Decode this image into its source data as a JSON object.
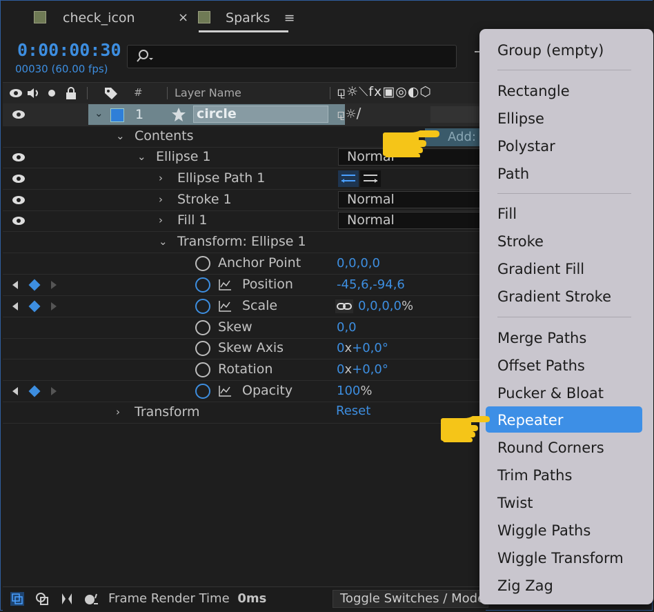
{
  "tabs": [
    {
      "label": "check_icon"
    },
    {
      "label": "Sparks"
    }
  ],
  "tab_close": "×",
  "tab_menu": "≡",
  "timecode": "0:00:00:30",
  "fps": "00030 (60.00 fps)",
  "search": {
    "placeholder": ""
  },
  "header": {
    "hash": "#",
    "layer_name": "Layer Name",
    "switches": "⚼☼⟍fx▣◎◐⬡"
  },
  "layer": {
    "number": "1",
    "name": "circle",
    "add_label": "Add:"
  },
  "rows": {
    "contents": "Contents",
    "ellipse1": "Ellipse 1",
    "ellipse1_mode": "Normal",
    "ellipse_path": "Ellipse Path 1",
    "stroke1": "Stroke 1",
    "stroke1_mode": "Normal",
    "fill1": "Fill 1",
    "fill1_mode": "Normal",
    "transform_ellipse": "Transform: Ellipse 1",
    "anchor": "Anchor Point",
    "anchor_val": "0,0,0,0",
    "position": "Position",
    "position_val": "-45,6,-94,6",
    "scale": "Scale",
    "scale_val": "0,0,0,0",
    "scale_unit": "%",
    "skew": "Skew",
    "skew_val": "0,0",
    "skew_axis": "Skew Axis",
    "skew_axis_val1": "0",
    "skew_axis_x": "x",
    "skew_axis_val2": "+0,0°",
    "rotation": "Rotation",
    "rotation_val1": "0",
    "rotation_x": "x",
    "rotation_val2": "+0,0°",
    "opacity": "Opacity",
    "opacity_val": "100",
    "opacity_unit": "%",
    "transform": "Transform",
    "reset": "Reset"
  },
  "footer": {
    "frame_render_label": "Frame Render Time",
    "frame_render_value": "0ms",
    "toggle": "Toggle Switches / Modes"
  },
  "menu": {
    "items": [
      "Group (empty)",
      "Rectangle",
      "Ellipse",
      "Polystar",
      "Path",
      "Fill",
      "Stroke",
      "Gradient Fill",
      "Gradient Stroke",
      "Merge Paths",
      "Offset Paths",
      "Pucker & Bloat",
      "Repeater",
      "Round Corners",
      "Trim Paths",
      "Twist",
      "Wiggle Paths",
      "Wiggle Transform",
      "Zig Zag"
    ],
    "highlighted": "Repeater"
  },
  "colors": {
    "accent": "#3d8ee0",
    "menu_bg": "#c9c6ce",
    "highlight": "#3d8fe6",
    "pointer": "#f5c518"
  }
}
